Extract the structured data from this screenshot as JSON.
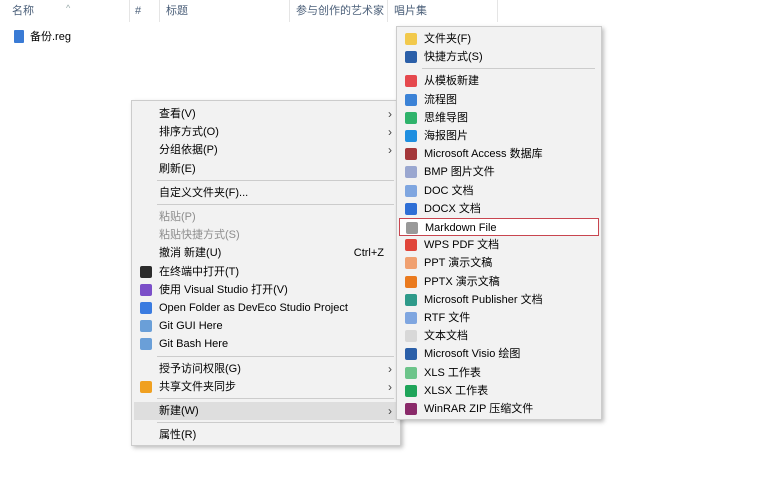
{
  "columns": [
    "名称",
    "#",
    "标题",
    "参与创作的艺术家",
    "唱片集"
  ],
  "file": {
    "name": "备份.reg",
    "icon": "registry-file-icon"
  },
  "context_menu": [
    {
      "label": "查看(V)",
      "arrow": true
    },
    {
      "label": "排序方式(O)",
      "arrow": true
    },
    {
      "label": "分组依据(P)",
      "arrow": true
    },
    {
      "label": "刷新(E)"
    },
    {
      "sep": true
    },
    {
      "label": "自定义文件夹(F)..."
    },
    {
      "sep": true
    },
    {
      "label": "粘贴(P)",
      "disabled": true
    },
    {
      "label": "粘贴快捷方式(S)",
      "disabled": true
    },
    {
      "label": "撤消 新建(U)",
      "shortcut": "Ctrl+Z"
    },
    {
      "label": "在终端中打开(T)",
      "icon": "terminal-icon",
      "color": "#2b2b2b"
    },
    {
      "label": "使用 Visual Studio 打开(V)",
      "icon": "visual-studio-icon",
      "color": "#7b4fc8"
    },
    {
      "label": "Open Folder as DevEco Studio Project",
      "icon": "deveco-icon",
      "color": "#3a7be0"
    },
    {
      "label": "Git GUI Here",
      "icon": "git-gui-icon",
      "color": "#6a9fd8"
    },
    {
      "label": "Git Bash Here",
      "icon": "git-bash-icon",
      "color": "#6a9fd8"
    },
    {
      "sep": true
    },
    {
      "label": "授予访问权限(G)",
      "arrow": true
    },
    {
      "label": "共享文件夹同步",
      "arrow": true,
      "icon": "share-sync-icon",
      "color": "#f0a020"
    },
    {
      "sep": true
    },
    {
      "label": "新建(W)",
      "arrow": true,
      "highlight": true
    },
    {
      "sep": true
    },
    {
      "label": "属性(R)"
    }
  ],
  "new_submenu": [
    {
      "label": "文件夹(F)",
      "icon": "folder-icon",
      "color": "#f2c94c"
    },
    {
      "label": "快捷方式(S)",
      "icon": "shortcut-icon",
      "color": "#2b5fa8"
    },
    {
      "sep": true
    },
    {
      "label": "从模板新建",
      "icon": "template-icon",
      "color": "#e5484d"
    },
    {
      "label": "流程图",
      "icon": "flowchart-icon",
      "color": "#3b82d6"
    },
    {
      "label": "思维导图",
      "icon": "mindmap-icon",
      "color": "#2fb36b"
    },
    {
      "label": "海报图片",
      "icon": "poster-icon",
      "color": "#1f8fe0"
    },
    {
      "label": "Microsoft Access 数据库",
      "icon": "access-icon",
      "color": "#a4373a"
    },
    {
      "label": "BMP 图片文件",
      "icon": "bmp-icon",
      "color": "#9aa7d0"
    },
    {
      "label": "DOC 文档",
      "icon": "doc-icon",
      "color": "#7fa6e0"
    },
    {
      "label": "DOCX 文档",
      "icon": "docx-icon",
      "color": "#2f6fd6"
    },
    {
      "label": "Markdown File",
      "icon": "markdown-icon",
      "color": "#999999",
      "boxed": true
    },
    {
      "label": "WPS PDF 文档",
      "icon": "pdf-icon",
      "color": "#e0453a"
    },
    {
      "label": "PPT 演示文稿",
      "icon": "ppt-icon",
      "color": "#f0a070"
    },
    {
      "label": "PPTX 演示文稿",
      "icon": "pptx-icon",
      "color": "#ea7a1e"
    },
    {
      "label": "Microsoft Publisher 文档",
      "icon": "publisher-icon",
      "color": "#2e9a8a"
    },
    {
      "label": "RTF 文件",
      "icon": "rtf-icon",
      "color": "#7fa6e0"
    },
    {
      "label": "文本文档",
      "icon": "text-file-icon",
      "color": "#d8d8d8"
    },
    {
      "label": "Microsoft Visio 绘图",
      "icon": "visio-icon",
      "color": "#2b5fa8"
    },
    {
      "label": "XLS 工作表",
      "icon": "xls-icon",
      "color": "#6cc48a"
    },
    {
      "label": "XLSX 工作表",
      "icon": "xlsx-icon",
      "color": "#1fa55a"
    },
    {
      "label": "WinRAR ZIP 压缩文件",
      "icon": "winrar-icon",
      "color": "#8a2a6a"
    }
  ]
}
